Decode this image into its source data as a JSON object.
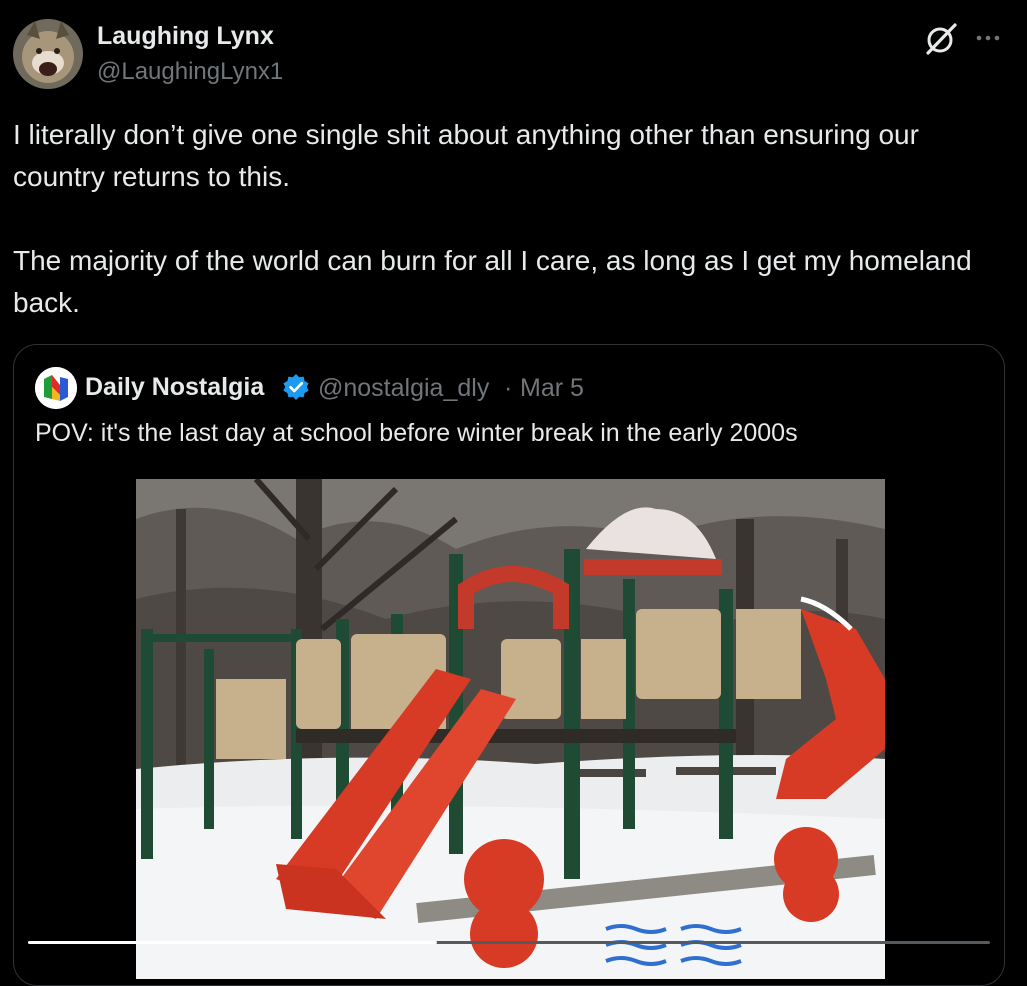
{
  "author": {
    "display_name": "Laughing Lynx",
    "handle": "@LaughingLynx1",
    "avatar_icon": "lynx-avatar"
  },
  "actions": {
    "grok_icon": "grok-icon",
    "more_icon": "more-options-icon"
  },
  "tweet": {
    "paragraphs": [
      "I literally don’t give one single shit about anything other than ensuring our country returns to this.",
      "The majority of the world can burn for all I care, as long as I get my homeland back."
    ]
  },
  "quote": {
    "display_name": "Daily Nostalgia",
    "verified": true,
    "handle": "@nostalgia_dly",
    "separator": "·",
    "date": "Mar 5",
    "text": "POV: it's the last day at school before winter break in the early 2000s",
    "avatar_icon": "n64-logo-avatar",
    "media": "snowy-playground-photo"
  },
  "video": {
    "progress": 0.425
  },
  "colors": {
    "background": "#000000",
    "text": "#e7e9ea",
    "secondary_text": "#71767b",
    "border": "#2f3336",
    "verified_blue": "#1d9bf0"
  }
}
